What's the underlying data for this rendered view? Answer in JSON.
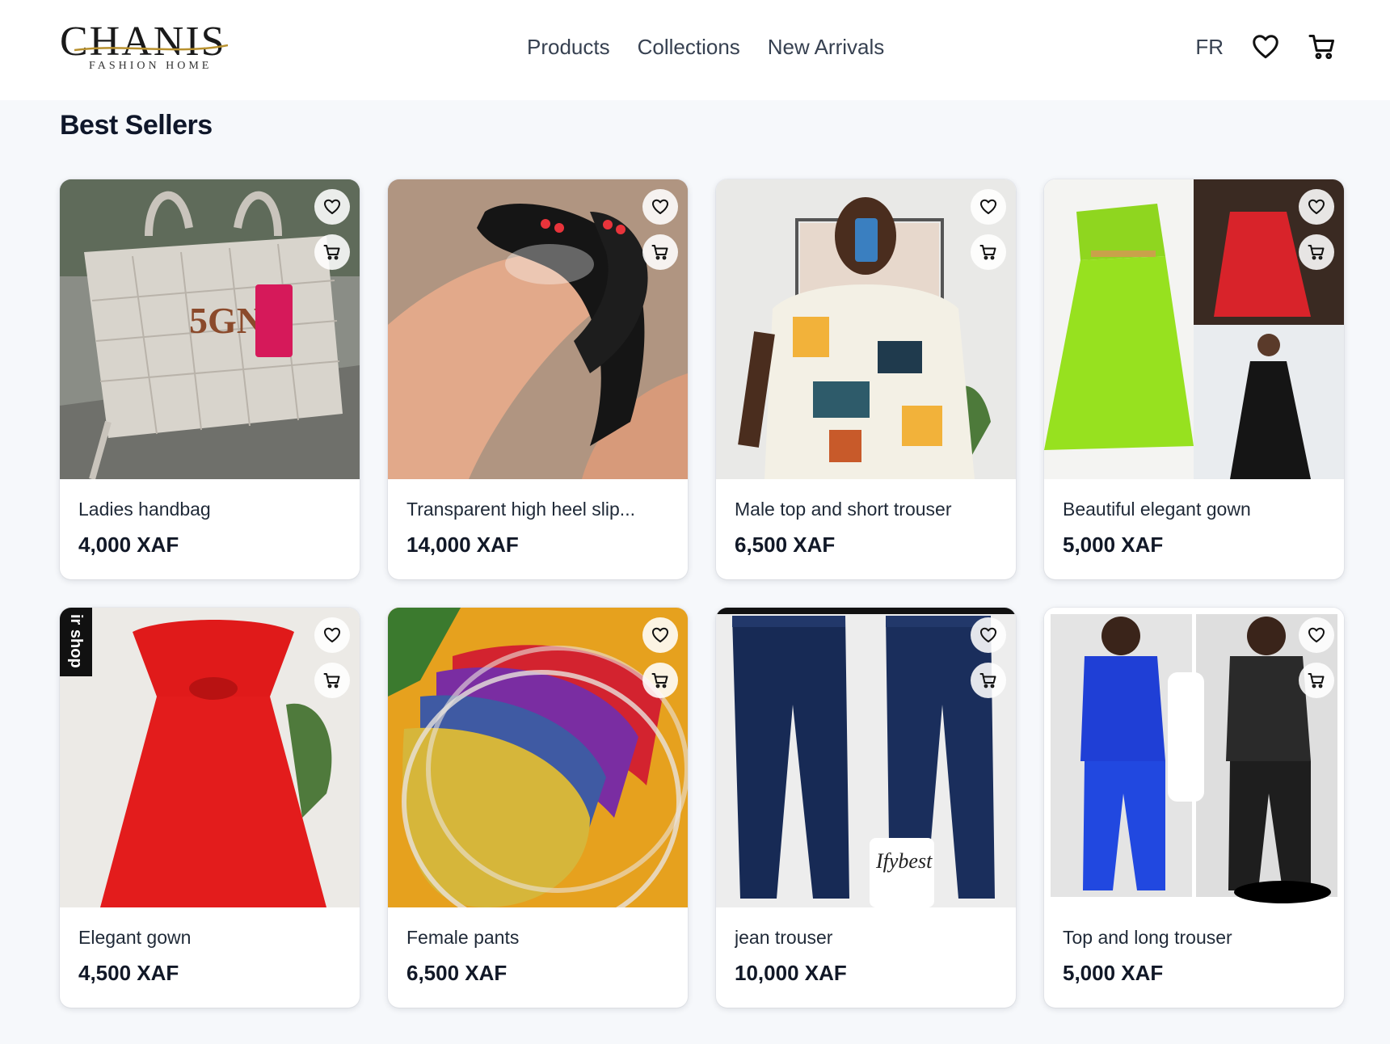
{
  "header": {
    "logo_main": "CHANIS",
    "logo_sub": "FASHION HOME",
    "nav": [
      "Products",
      "Collections",
      "New Arrivals"
    ],
    "language": "FR",
    "icons": [
      "heart-icon",
      "cart-icon"
    ]
  },
  "section": {
    "title": "Best Sellers"
  },
  "products": [
    {
      "name": "Ladies handbag",
      "price": "4,000 XAF",
      "image_text": "5GN"
    },
    {
      "name": "Transparent high heel slip...",
      "price": "14,000 XAF"
    },
    {
      "name": "Male top and short trouser",
      "price": "6,500 XAF"
    },
    {
      "name": "Beautiful elegant gown",
      "price": "5,000 XAF"
    },
    {
      "name": "Elegant gown",
      "price": "4,500 XAF",
      "image_text": "ir shop"
    },
    {
      "name": "Female pants",
      "price": "6,500 XAF"
    },
    {
      "name": "jean trouser",
      "price": "10,000 XAF",
      "image_text": "Ifybest"
    },
    {
      "name": "Top and long trouser",
      "price": "5,000 XAF"
    }
  ],
  "colors": {
    "page_bg": "#f6f8fb",
    "header_bg": "#ffffff",
    "text_dark": "#0f172a",
    "nav_text": "#374151"
  }
}
